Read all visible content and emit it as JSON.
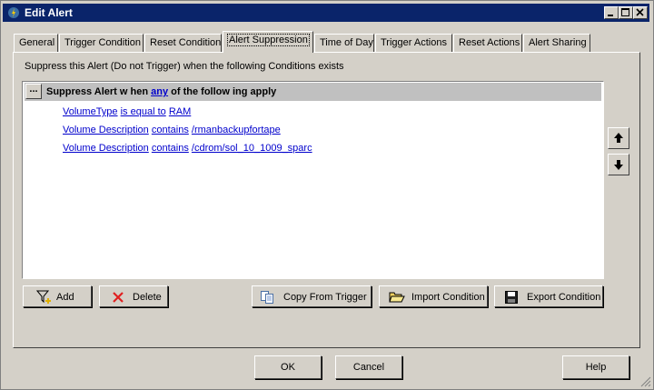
{
  "window": {
    "title": "Edit Alert"
  },
  "tabs": [
    "General",
    "Trigger Condition",
    "Reset Condition",
    "Alert Suppression",
    "Time of Day",
    "Trigger Actions",
    "Reset Actions",
    "Alert Sharing"
  ],
  "active_tab": "Alert Suppression",
  "panel": {
    "label": "Suppress this Alert (Do not Trigger) when the following Conditions exists",
    "list": {
      "header_prefix": "Suppress Alert w hen",
      "header_link": "any",
      "header_suffix": "of the follow ing apply",
      "ellipsis": "...",
      "conditions": [
        {
          "field": "VolumeType",
          "operator": "is equal to",
          "value": "RAM"
        },
        {
          "field": "Volume Description",
          "operator": "contains",
          "value": "/rmanbackupfortape"
        },
        {
          "field": "Volume Description",
          "operator": "contains",
          "value": "/cdrom/sol_10_1009_sparc"
        }
      ]
    },
    "buttons": {
      "add": "Add",
      "delete": "Delete",
      "copy_from_trigger": "Copy From Trigger",
      "import_condition": "Import Condition",
      "export_condition": "Export Condition"
    }
  },
  "footer": {
    "ok": "OK",
    "cancel": "Cancel",
    "help": "Help"
  },
  "colors": {
    "titlebar": "#0a246a",
    "link": "#0000cc",
    "face": "#d4d0c8"
  }
}
